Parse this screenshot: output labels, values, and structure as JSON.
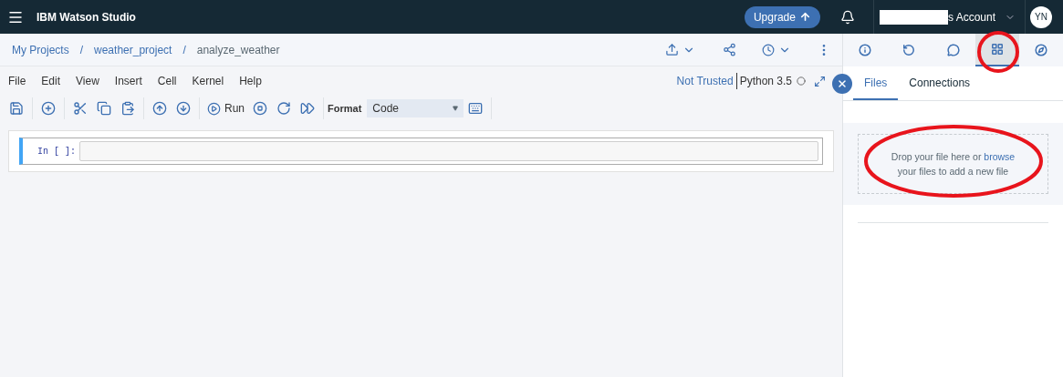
{
  "header": {
    "title": "IBM Watson Studio",
    "upgrade_label": "Upgrade",
    "account_label": "s Account",
    "avatar_initials": "YN"
  },
  "breadcrumb_separator": "/",
  "breadcrumbs": [
    {
      "label": "My Projects",
      "current": false
    },
    {
      "label": "weather_project",
      "current": false
    },
    {
      "label": "analyze_weather",
      "current": true
    }
  ],
  "menu": [
    "File",
    "Edit",
    "View",
    "Insert",
    "Cell",
    "Kernel",
    "Help"
  ],
  "kernel": {
    "trust": "Not Trusted",
    "name": "Python 3.5"
  },
  "toolbar": {
    "run_label": "Run",
    "format_label": "Format",
    "cell_type": "Code"
  },
  "cell": {
    "prompt": "In [ ]:"
  },
  "side_panel": {
    "icon_tabs": [
      {
        "kind": "info",
        "selected": false,
        "circled": false
      },
      {
        "kind": "history",
        "selected": false,
        "circled": false
      },
      {
        "kind": "comments",
        "selected": false,
        "circled": false
      },
      {
        "kind": "data",
        "selected": true,
        "circled": true
      },
      {
        "kind": "compass",
        "selected": false,
        "circled": false
      }
    ],
    "tabs": [
      {
        "label": "Files",
        "selected": true
      },
      {
        "label": "Connections",
        "selected": false
      }
    ],
    "drop_zone": {
      "text": "Drop your file here or ",
      "link": "browse",
      "text_after": "your files to add a new file",
      "circled": true
    }
  }
}
